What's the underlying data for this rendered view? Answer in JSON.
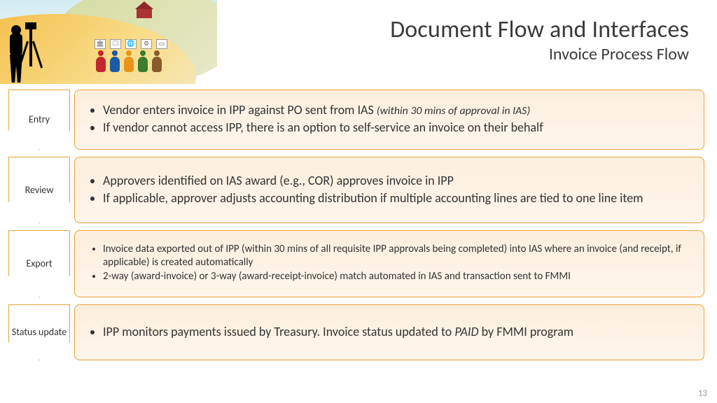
{
  "title": {
    "main": "Document Flow and Interfaces",
    "sub": "Invoice Process Flow"
  },
  "steps": [
    {
      "label": "Entry",
      "bullets": [
        {
          "pre": "Vendor enters invoice in IPP against PO sent from IAS ",
          "note": "(within 30 mins of approval in IAS)"
        },
        {
          "text": "If vendor cannot access IPP, there is an option to self-service an invoice on their behalf"
        }
      ]
    },
    {
      "label": "Review",
      "bullets": [
        {
          "text": "Approvers identified on IAS award (e.g., COR) approves invoice in IPP"
        },
        {
          "text": "If applicable, approver adjusts accounting distribution if multiple accounting lines are tied to one line item"
        }
      ]
    },
    {
      "label": "Export",
      "bullets": [
        {
          "text": "Invoice data exported out of IPP (within 30 mins of all requisite IPP approvals being completed) into IAS where an invoice (and receipt, if applicable) is created automatically"
        },
        {
          "text": "2-way (award-invoice) or 3-way (award-receipt-invoice) match automated in IAS and transaction sent to FMMI"
        }
      ]
    },
    {
      "label": "Status update",
      "bullets": [
        {
          "pre": "IPP monitors payments issued by Treasury. Invoice status updated to ",
          "paid": "PAID",
          "post": " by FMMI program"
        }
      ]
    }
  ],
  "page_number": "13"
}
